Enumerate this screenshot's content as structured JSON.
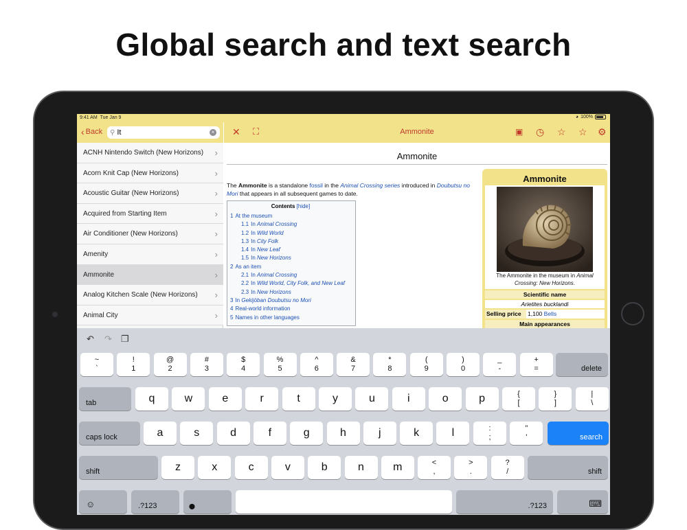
{
  "headline": "Global search and text search",
  "status": {
    "time": "9:41 AM",
    "date": "Tue Jan 9",
    "battery": "100%"
  },
  "left": {
    "back_label": "Back",
    "search_value": "It",
    "items": [
      {
        "label": "ACNH Nintendo Switch (New Horizons)",
        "selected": false
      },
      {
        "label": "Acorn Knit Cap (New Horizons)",
        "selected": false
      },
      {
        "label": "Acoustic Guitar (New Horizons)",
        "selected": false
      },
      {
        "label": "Acquired from Starting Item",
        "selected": false
      },
      {
        "label": "Air Conditioner (New Horizons)",
        "selected": false
      },
      {
        "label": "Amenity",
        "selected": false
      },
      {
        "label": "Ammonite",
        "selected": true
      },
      {
        "label": "Analog Kitchen Scale (New Horizons)",
        "selected": false
      },
      {
        "label": "Animal City",
        "selected": false
      }
    ]
  },
  "right": {
    "title": "Ammonite",
    "article_title": "Ammonite",
    "intro": {
      "t1": "The ",
      "bold": "Ammonite",
      "t2": " is a standalone ",
      "link1": "fossil",
      "t3": " in the ",
      "link2": "Animal Crossing series",
      "t4": " introduced in ",
      "link3": "Doubutsu no Mori",
      "t5": " that appears in all subsequent games to date."
    },
    "toc": {
      "title": "Contents",
      "hide": "[hide]",
      "items": [
        {
          "num": "1",
          "text": "At the museum",
          "sub": false,
          "italic": false
        },
        {
          "num": "1.1",
          "text": "Animal Crossing",
          "pre": "In ",
          "sub": true,
          "italic": true
        },
        {
          "num": "1.2",
          "text": "Wild World",
          "pre": "In ",
          "sub": true,
          "italic": true
        },
        {
          "num": "1.3",
          "text": "City Folk",
          "pre": "In ",
          "sub": true,
          "italic": true
        },
        {
          "num": "1.4",
          "text": "New Leaf",
          "pre": "In ",
          "sub": true,
          "italic": true
        },
        {
          "num": "1.5",
          "text": "New Horizons",
          "pre": "In ",
          "sub": true,
          "italic": true
        },
        {
          "num": "2",
          "text": "As an item",
          "sub": false,
          "italic": false
        },
        {
          "num": "2.1",
          "text": "Animal Crossing",
          "pre": "In ",
          "sub": true,
          "italic": true
        },
        {
          "num": "2.2",
          "text": "Wild World, City Folk, and New Leaf",
          "pre": "In ",
          "sub": true,
          "italic": true
        },
        {
          "num": "2.3",
          "text": "New Horizons",
          "pre": "In ",
          "sub": true,
          "italic": true
        },
        {
          "num": "3",
          "text": "Gekijōban Doubutsu no Mori",
          "pre": "In ",
          "sub": false,
          "italic": true
        },
        {
          "num": "4",
          "text": "Real-world information",
          "sub": false,
          "italic": false
        },
        {
          "num": "5",
          "text": "Names in other languages",
          "sub": false,
          "italic": false
        }
      ]
    },
    "infobox": {
      "title": "Ammonite",
      "caption_pre": "The Ammonite in the museum in ",
      "caption_it": "Animal Crossing: New Horizons",
      "caption_post": ".",
      "sci_label": "Scientific name",
      "sci_value": "Arietites bucklandi",
      "price_label": "Selling price",
      "price_value": "1,100",
      "price_unit": "Bells",
      "appearances_label": "Main appearances"
    }
  },
  "keyboard": {
    "row1": [
      {
        "top": "~",
        "bot": "`"
      },
      {
        "top": "!",
        "bot": "1"
      },
      {
        "top": "@",
        "bot": "2"
      },
      {
        "top": "#",
        "bot": "3"
      },
      {
        "top": "$",
        "bot": "4"
      },
      {
        "top": "%",
        "bot": "5"
      },
      {
        "top": "^",
        "bot": "6"
      },
      {
        "top": "&",
        "bot": "7"
      },
      {
        "top": "*",
        "bot": "8"
      },
      {
        "top": "(",
        "bot": "9"
      },
      {
        "top": ")",
        "bot": "0"
      },
      {
        "top": "_",
        "bot": "-"
      },
      {
        "top": "+",
        "bot": "="
      }
    ],
    "delete": "delete",
    "tab": "tab",
    "row2": [
      "q",
      "w",
      "e",
      "r",
      "t",
      "y",
      "u",
      "i",
      "o",
      "p"
    ],
    "row2_extra": [
      {
        "top": "{",
        "bot": "["
      },
      {
        "top": "}",
        "bot": "]"
      },
      {
        "top": "|",
        "bot": "\\"
      }
    ],
    "caps": "caps lock",
    "row3": [
      "a",
      "s",
      "d",
      "f",
      "g",
      "h",
      "j",
      "k",
      "l"
    ],
    "row3_extra": [
      {
        "top": ":",
        "bot": ";"
      },
      {
        "top": "\"",
        "bot": "'"
      }
    ],
    "search": "search",
    "shift": "shift",
    "row4": [
      "z",
      "x",
      "c",
      "v",
      "b",
      "n",
      "m"
    ],
    "row4_extra": [
      {
        "top": "<",
        "bot": ","
      },
      {
        "top": ">",
        "bot": "."
      },
      {
        "top": "?",
        "bot": "/"
      }
    ],
    "numkey": ".?123",
    "colors": {
      "bg": "#d2d5db",
      "accent": "#1b82f8",
      "bar": "#f2e38a",
      "tint": "#c0392b"
    }
  }
}
